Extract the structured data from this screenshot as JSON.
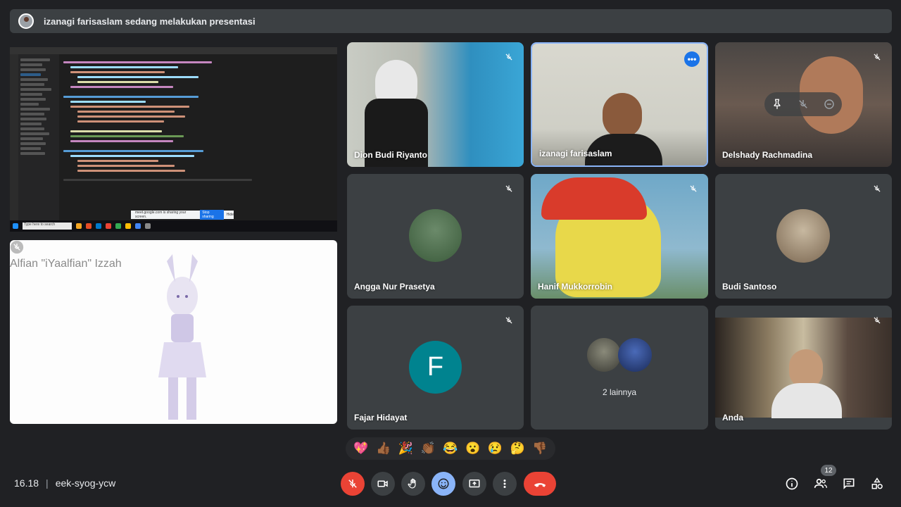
{
  "banner": {
    "presenting_text": "izanagi farisaslam sedang melakukan presentasi"
  },
  "screen_share": {
    "search_placeholder": "Type here to search",
    "sharing_text": "meet.google.com is sharing your screen.",
    "stop_sharing_label": "Stop sharing",
    "hide_label": "Hide"
  },
  "pinned": {
    "name": "Alfian \"iYaalfian\" Izzah"
  },
  "participants": [
    {
      "name": "Dion Budi Riyanto"
    },
    {
      "name": "izanagi farisaslam"
    },
    {
      "name": "Delshady Rachmadina"
    },
    {
      "name": "Angga Nur Prasetya"
    },
    {
      "name": "Hanif Mukkorrobin"
    },
    {
      "name": "Budi Santoso"
    },
    {
      "name": "Fajar Hidayat",
      "initial": "F",
      "color": "#00838f"
    },
    {
      "more_label": "2 lainnya"
    },
    {
      "name": "Anda"
    }
  ],
  "reactions": [
    "💖",
    "👍🏾",
    "🎉",
    "👏🏾",
    "😂",
    "😮",
    "😢",
    "🤔",
    "👎🏾"
  ],
  "bottom": {
    "time": "16.18",
    "meeting_code": "eek-syog-ycw",
    "participant_count": "12"
  },
  "colors": {
    "accent": "#8ab4f8",
    "danger": "#ea4335",
    "surface": "#3c4043",
    "background": "#202124"
  }
}
